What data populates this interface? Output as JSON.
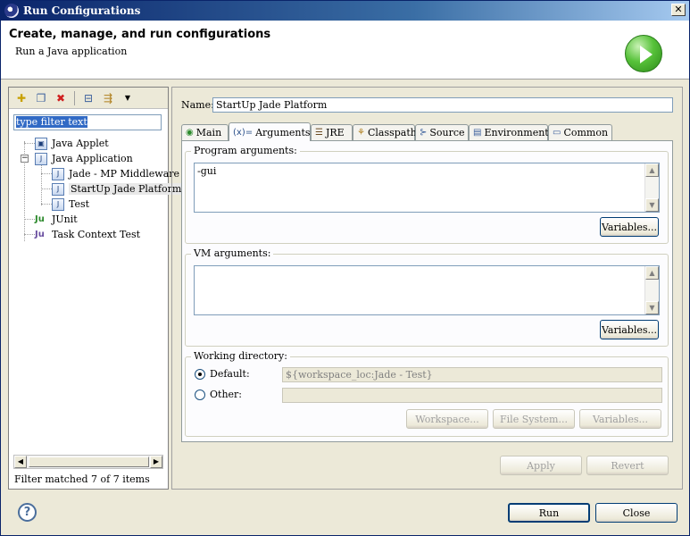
{
  "window": {
    "title": "Run Configurations",
    "close_glyph": "✕"
  },
  "header": {
    "title": "Create, manage, and run configurations",
    "subtitle": "Run a Java application"
  },
  "left": {
    "filter_text": "type filter text",
    "toolbar_icons": [
      "new-config-icon",
      "duplicate-icon",
      "delete-icon",
      "collapse-all-icon",
      "filter-icon",
      "menu-arrow-icon"
    ],
    "tree": [
      {
        "label": "Java Applet",
        "icon": "applet-icon"
      },
      {
        "label": "Java Application",
        "icon": "java-app-icon",
        "expanded": true
      },
      {
        "label": "Jade - MP Middleware",
        "icon": "java-app-icon"
      },
      {
        "label": "StartUp Jade Platform",
        "icon": "java-app-icon",
        "selected": true
      },
      {
        "label": "Test",
        "icon": "java-app-icon"
      },
      {
        "label": "JUnit",
        "icon": "junit-icon"
      },
      {
        "label": "Task Context Test",
        "icon": "junit-task-icon"
      }
    ],
    "filter_status": "Filter matched 7 of 7 items"
  },
  "right": {
    "name_label": "Name:",
    "name_value": "StartUp Jade Platform",
    "tabs": [
      {
        "label": "Main",
        "icon": "main-tab-icon"
      },
      {
        "label": "Arguments",
        "icon": "arguments-tab-icon",
        "active": true
      },
      {
        "label": "JRE",
        "icon": "jre-tab-icon"
      },
      {
        "label": "Classpath",
        "icon": "classpath-tab-icon"
      },
      {
        "label": "Source",
        "icon": "source-tab-icon"
      },
      {
        "label": "Environment",
        "icon": "environment-tab-icon"
      },
      {
        "label": "Common",
        "icon": "common-tab-icon"
      }
    ],
    "program_args": {
      "title": "Program arguments:",
      "value": "-gui",
      "variables": "Variables..."
    },
    "vm_args": {
      "title": "VM arguments:",
      "value": "",
      "variables": "Variables..."
    },
    "working_dir": {
      "title": "Working directory:",
      "default_label": "Default:",
      "default_value": "${workspace_loc:Jade - Test}",
      "other_label": "Other:",
      "other_value": "",
      "selected": "default",
      "workspace": "Workspace...",
      "file_system": "File System...",
      "variables": "Variables..."
    },
    "apply": "Apply",
    "revert": "Revert"
  },
  "footer": {
    "run": "Run",
    "close": "Close"
  }
}
